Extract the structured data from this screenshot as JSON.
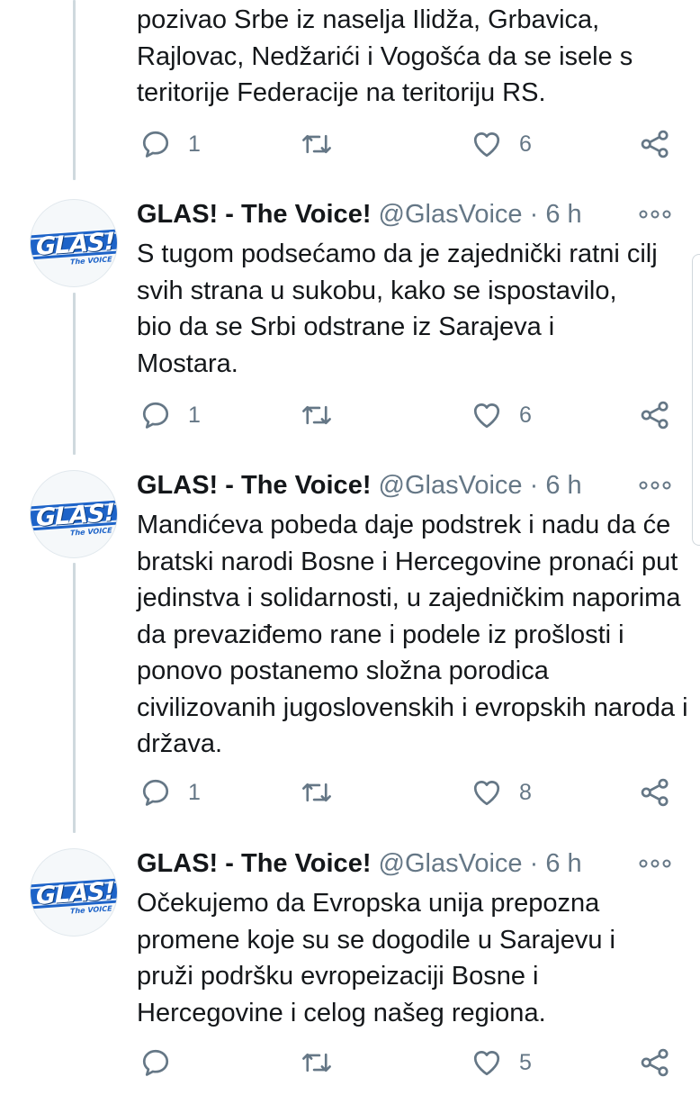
{
  "partial_tweet": {
    "text": "pozivao Srbe iz naselja Ilidža, Grbavica, Rajlovac, Nedžarići i Vogošća da se isele s teritorije Federacije na teritoriju RS.",
    "replies": "1",
    "likes": "6"
  },
  "tweets": [
    {
      "name": "GLAS! - The Voice!",
      "handle": "@GlasVoice",
      "dot": "·",
      "time": "6 h",
      "avatar_logo": "GLAS!",
      "avatar_sub": "The VOICE",
      "text": "S tugom podsećamo da je zajednički ratni cilj svih strana u sukobu, kako se ispostavilo, bio da se Srbi odstrane iz Sarajeva i Mostara.",
      "replies": "1",
      "likes": "6"
    },
    {
      "name": "GLAS! - The Voice!",
      "handle": "@GlasVoice",
      "dot": "·",
      "time": "6 h",
      "avatar_logo": "GLAS!",
      "avatar_sub": "The VOICE",
      "text": "Mandićeva pobeda daje podstrek i nadu da će bratski narodi Bosne i Hercegovine pronaći put jedinstva i solidarnosti, u zajedničkim naporima da prevaziđemo rane i podele iz prošlosti i ponovo postanemo složna porodica civilizovanih jugoslovenskih i evropskih naroda i država.",
      "replies": "1",
      "likes": "8"
    },
    {
      "name": "GLAS! - The Voice!",
      "handle": "@GlasVoice",
      "dot": "·",
      "time": "6 h",
      "avatar_logo": "GLAS!",
      "avatar_sub": "The VOICE",
      "text": "Očekujemo da Evropska unija prepozna promene koje su se dogodile u Sarajevu i pruži podršku evropeizaciji Bosne i Hercegovine i celog našeg regiona.",
      "replies": "",
      "likes": "5"
    }
  ],
  "icons": {
    "reply": "reply-icon",
    "retweet": "retweet-icon",
    "like": "heart-icon",
    "share": "share-icon",
    "more": "more-options-icon"
  },
  "colors": {
    "icon_gray": "#657786",
    "thread_line": "#cfd9de",
    "logo_blue": "#1d63c8"
  }
}
